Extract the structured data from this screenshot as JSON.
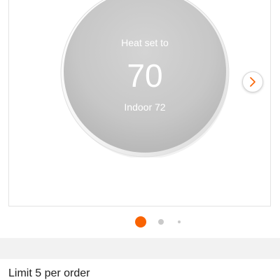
{
  "product_image": {
    "display_label": "Heat set to",
    "display_temperature": "70",
    "display_indoor": "Indoor 72",
    "next_icon": "chevron-right-icon"
  },
  "carousel": {
    "image_count": 3,
    "active_index": 0,
    "active_color": "#f96302",
    "inactive_color": "#c9c9c9"
  },
  "purchase": {
    "limit_text": "Limit 5 per order"
  },
  "colors": {
    "accent": "#f96302",
    "band": "#f2f2f2"
  }
}
